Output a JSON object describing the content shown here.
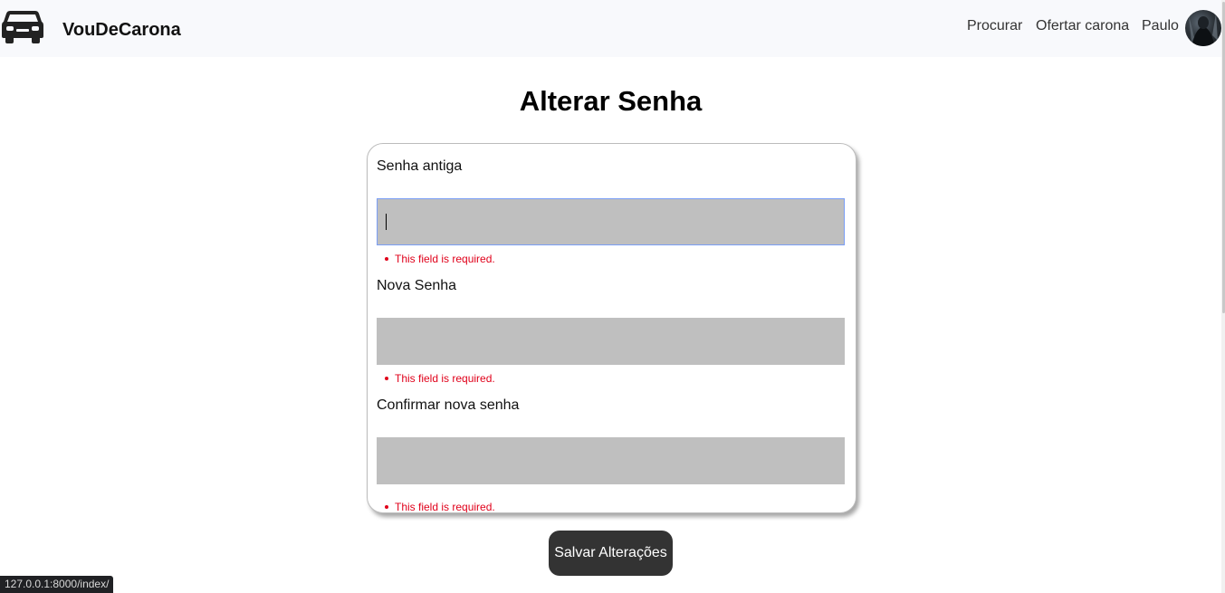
{
  "navbar": {
    "brand": "VouDeCarona",
    "brand_icon": "car-icon",
    "links": {
      "procurar": "Procurar",
      "ofertar": "Ofertar carona",
      "user": "Paulo"
    },
    "background": "#f8f9fc"
  },
  "page": {
    "title": "Alterar Senha"
  },
  "form": {
    "fields": [
      {
        "label": "Senha antiga",
        "value": "",
        "focused": true,
        "error": "This field is required."
      },
      {
        "label": "Nova Senha",
        "value": "",
        "focused": false,
        "error": "This field is required."
      },
      {
        "label": "Confirmar nova senha",
        "value": "",
        "focused": false,
        "error": "This field is required."
      }
    ],
    "submit_label": "Salvar Alterações",
    "input_color": "#bfbfbf",
    "error_color": "#e0001a",
    "button_color": "#333333"
  },
  "status_bar": {
    "url": "127.0.0.1:8000/index/"
  }
}
